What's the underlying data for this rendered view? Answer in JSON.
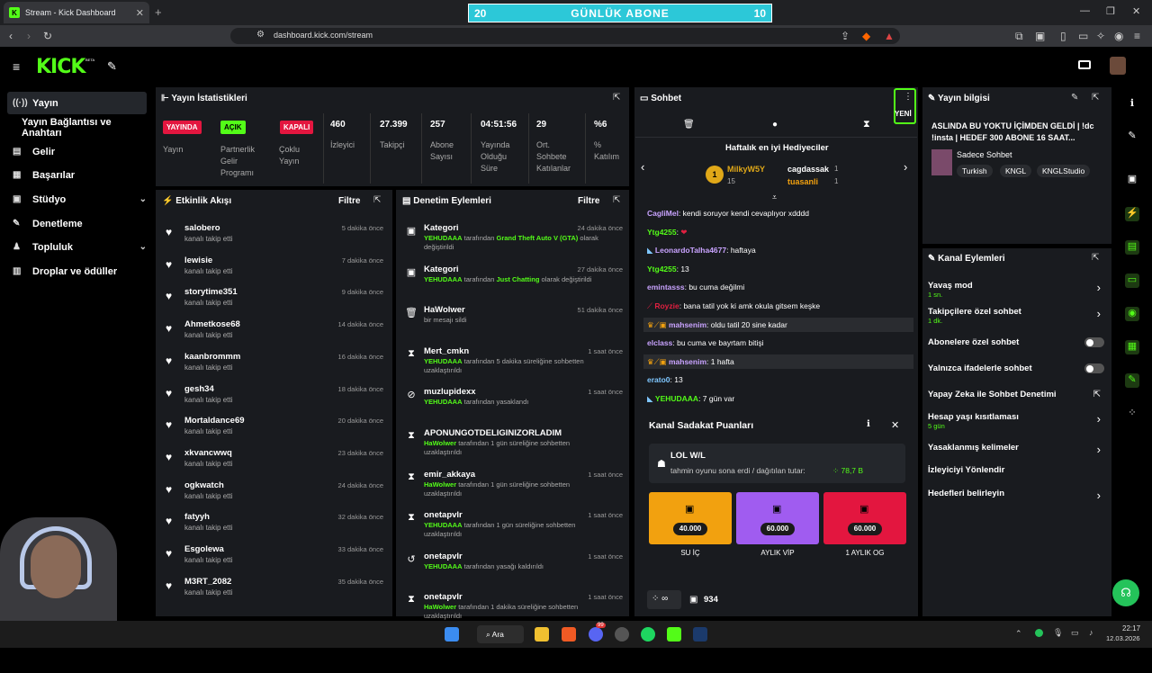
{
  "browser": {
    "tab_title": "Stream - Kick Dashboard",
    "url": "dashboard.kick.com/stream"
  },
  "overlay": {
    "left": "20",
    "title": "GÜNLÜK ABONE",
    "right": "10"
  },
  "sidebar": {
    "items": [
      {
        "label": "Yayın",
        "icon": "broadcast-icon"
      },
      {
        "label": "Yayın Bağlantısı ve Anahtarı"
      },
      {
        "label": "Gelir",
        "icon": "money-icon"
      },
      {
        "label": "Başarılar",
        "icon": "achievement-icon"
      },
      {
        "label": "Stüdyo",
        "icon": "studio-icon"
      },
      {
        "label": "Denetleme",
        "icon": "wrench-icon"
      },
      {
        "label": "Topluluk",
        "icon": "community-icon"
      },
      {
        "label": "Droplar ve ödüller",
        "icon": "chart-icon"
      }
    ]
  },
  "stats": {
    "title": "Yayın İstatistikleri",
    "yayinda": "YAYINDA",
    "yayin": "Yayın",
    "acik": "AÇIK",
    "partner": "Partnerlik Gelir Programı",
    "kapali": "KAPALI",
    "coklu": "Çoklu Yayın",
    "izleyici_v": "460",
    "izleyici": "İzleyici",
    "takipci_v": "27.399",
    "takipci": "Takipçi",
    "abone_v": "257",
    "abone": "Abone Sayısı",
    "sure_v": "04:51:56",
    "sure": "Yayında Olduğu Süre",
    "ort_v": "29",
    "ort": "Ort. Sohbete Katılanlar",
    "katilim_v": "%6",
    "katilim": "% Katılım"
  },
  "activity": {
    "title": "Etkinlik Akışı",
    "filter": "Filtre",
    "sub": "kanalı takip etti",
    "items": [
      {
        "name": "salobero",
        "time": "5 dakika önce"
      },
      {
        "name": "lewisie",
        "time": "7 dakika önce"
      },
      {
        "name": "storytime351",
        "time": "9 dakika önce"
      },
      {
        "name": "Ahmetkose68",
        "time": "14 dakika önce"
      },
      {
        "name": "kaanbrommm",
        "time": "16 dakika önce"
      },
      {
        "name": "gesh34",
        "time": "18 dakika önce"
      },
      {
        "name": "Mortaldance69",
        "time": "20 dakika önce"
      },
      {
        "name": "xkvancwwq",
        "time": "23 dakika önce"
      },
      {
        "name": "ogkwatch",
        "time": "24 dakika önce"
      },
      {
        "name": "fatyyh",
        "time": "32 dakika önce"
      },
      {
        "name": "Esgolewa",
        "time": "33 dakika önce"
      },
      {
        "name": "M3RT_2082",
        "time": "35 dakika önce"
      }
    ]
  },
  "modlog": {
    "title": "Denetim Eylemleri",
    "filter": "Filtre",
    "items": [
      {
        "name": "Kategori",
        "time": "24 dakika önce",
        "actor": "YEHUDAAA",
        "text": "tarafından",
        "extra": "Grand Theft Auto V (GTA)",
        "tail": "olarak değiştirildi",
        "icon": "category-icon"
      },
      {
        "name": "Kategori",
        "time": "27 dakika önce",
        "actor": "YEHUDAAA",
        "text": "tarafından",
        "extra": "Just Chatting",
        "tail": "olarak değiştirildi",
        "icon": "category-icon"
      },
      {
        "name": "HaWolwer",
        "time": "51 dakika önce",
        "actor": "",
        "text": "bir mesajı sildi",
        "extra": "",
        "tail": "",
        "icon": "trash-icon"
      },
      {
        "name": "Mert_cmkn",
        "time": "1 saat önce",
        "actor": "YEHUDAAA",
        "text": "tarafından 5 dakika süreliğine sohbetten uzaklaştırıldı",
        "extra": "",
        "tail": "",
        "icon": "hourglass-icon"
      },
      {
        "name": "muzlupidexx",
        "time": "1 saat önce",
        "actor": "YEHUDAAA",
        "text": "tarafından yasaklandı",
        "extra": "",
        "tail": "",
        "icon": "ban-icon"
      },
      {
        "name": "APONUNGOTDELIGINIZORLADIM",
        "time": "",
        "actor": "HaWolwer",
        "text": "tarafından 1 gün süreliğine sohbetten uzaklaştırıldı",
        "extra": "",
        "tail": "",
        "icon": "hourglass-icon"
      },
      {
        "name": "emir_akkaya",
        "time": "1 saat önce",
        "actor": "HaWolwer",
        "text": "tarafından 1 gün süreliğine sohbetten uzaklaştırıldı",
        "extra": "",
        "tail": "",
        "icon": "hourglass-icon"
      },
      {
        "name": "onetapvlr",
        "time": "1 saat önce",
        "actor": "YEHUDAAA",
        "text": "tarafından 1 gün süreliğine sohbetten uzaklaştırıldı",
        "extra": "",
        "tail": "",
        "icon": "hourglass-icon"
      },
      {
        "name": "onetapvlr",
        "time": "1 saat önce",
        "actor": "YEHUDAAA",
        "text": "tarafından yasağı kaldırıldı",
        "extra": "",
        "tail": "",
        "icon": "undo-icon"
      },
      {
        "name": "onetapvlr",
        "time": "1 saat önce",
        "actor": "HaWolwer",
        "text": "tarafından 1 dakika süreliğine sohbetten uzaklaştırıldı",
        "extra": "",
        "tail": "",
        "icon": "hourglass-icon"
      },
      {
        "name": "onetapvlr",
        "time": "1 saat önce",
        "actor": "",
        "text": "",
        "extra": "",
        "tail": "",
        "icon": "hourglass-icon"
      }
    ]
  },
  "chat": {
    "title": "Sohbet",
    "new_label": "YENİ",
    "gifters_title": "Haftalık en iyi Hediyeciler",
    "gifter1": "MilkyW5Y",
    "gifter1_count": "15",
    "gifter2": "cagdassak",
    "gifter2_count": "1",
    "gifter3": "tuasanli",
    "gifter3_count": "1",
    "messages": [
      {
        "user": "CagliMel",
        "color": "#c9a3ff",
        "text": ": kendi soruyor kendi cevaplıyor xdddd"
      },
      {
        "user": "Ytg4255",
        "color": "#53fc18",
        "text": ":"
      },
      {
        "user": "LeonardoTalha4677",
        "color": "#c9a3ff",
        "text": ": haftaya"
      },
      {
        "user": "Ytg4255",
        "color": "#53fc18",
        "text": ": 13"
      },
      {
        "user": "emintasss",
        "color": "#c9a3ff",
        "text": ": bu cuma değilmi"
      },
      {
        "user": "Royzie",
        "color": "#e02040",
        "text": ": bana tatil yok ki amk okula gitsem keşke"
      },
      {
        "user": "mahsenim",
        "color": "#c9a3ff",
        "text": ": oldu tatil 20 sine kadar"
      },
      {
        "user": "elclass",
        "color": "#c9a3ff",
        "text": ": bu cuma ve bayrtam bitişi"
      },
      {
        "user": "mahsenim",
        "color": "#c9a3ff",
        "text": ": 1 hafta"
      },
      {
        "user": "erato0",
        "color": "#7fc7ff",
        "text": ": 13"
      },
      {
        "user": "YEHUDAAA",
        "color": "#53fc18",
        "text": ": 7 gün var"
      }
    ],
    "loyalty": {
      "title": "Kanal Sadakat Puanları",
      "prediction": "LOL W/L",
      "prediction_sub": "tahmin oyunu sona erdi / dağıtılan tutar:",
      "prediction_amount": "78,7 B",
      "rewards": [
        {
          "cost": "40.000",
          "label": "SU İÇ",
          "color": "#f2a10f"
        },
        {
          "cost": "60.000",
          "label": "AYLIK VİP",
          "color": "#a05cf0"
        },
        {
          "cost": "60.000",
          "label": "1 AYLIK OG",
          "color": "#e3163f"
        }
      ]
    },
    "points": "934",
    "infinity": "∞"
  },
  "streaminfo": {
    "title": "Yayın bilgisi",
    "stream_title": "ASLINDA BU YOKTU İÇİMDEN GELDİ | !dc !insta | HEDEF 300 ABONE 16 SAAT...",
    "chat_mode": "Sadece Sohbet",
    "tags": [
      "Turkish",
      "KNGL",
      "KNGLStudio"
    ]
  },
  "channel_actions": {
    "title": "Kanal Eylemleri",
    "slow": "Yavaş mod",
    "slow_sub": "1 sn.",
    "followers": "Takipçilere özel sohbet",
    "followers_sub": "1 dk.",
    "subs": "Abonelere özel sohbet",
    "emotes": "Yalnızca ifadelerle sohbet",
    "ai": "Yapay Zeka ile Sohbet Denetimi",
    "age": "Hesap yaşı kısıtlaması",
    "age_sub": "5 gün",
    "banned": "Yasaklanmış kelimeler",
    "redirect": "İzleyiciyi Yönlendir",
    "goals": "Hedefleri belirleyin"
  },
  "taskbar": {
    "search": "Ara",
    "time": "22:17",
    "date": "12.03.2026",
    "badge": "99"
  }
}
